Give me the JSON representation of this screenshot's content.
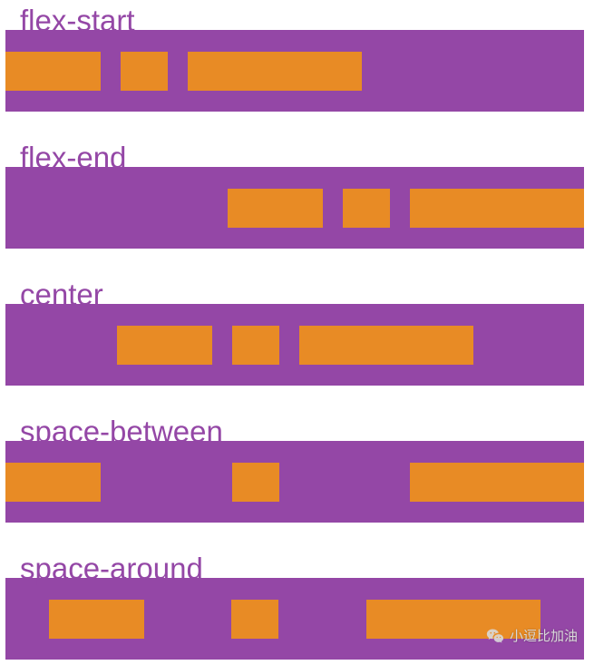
{
  "colors": {
    "container_bg": "#9447a6",
    "box_bg": "#e88b25",
    "label_text": "#9447a6"
  },
  "sections": [
    {
      "id": "flex-start",
      "label": "flex-start",
      "justify": "flex-start"
    },
    {
      "id": "flex-end",
      "label": "flex-end",
      "justify": "flex-end"
    },
    {
      "id": "center",
      "label": "center",
      "justify": "center"
    },
    {
      "id": "space-between",
      "label": "space-between",
      "justify": "space-between"
    },
    {
      "id": "space-around",
      "label": "space-around",
      "justify": "space-around"
    }
  ],
  "watermark": {
    "text": "小逗比加油",
    "icon": "wechat-icon"
  }
}
